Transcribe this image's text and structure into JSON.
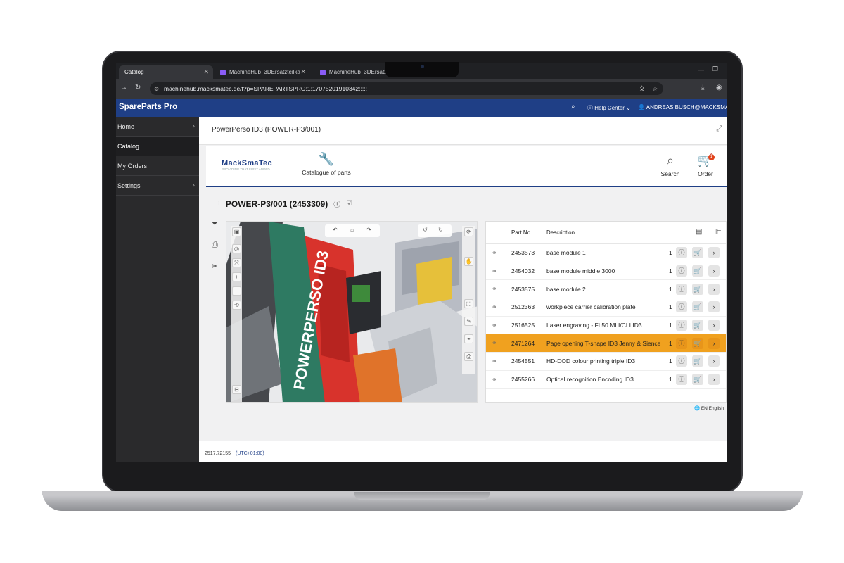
{
  "browser": {
    "tabs": [
      {
        "label": "Catalog",
        "active": true
      },
      {
        "label": "MachineHub_3DErsatzteilkatal",
        "active": false
      },
      {
        "label": "MachineHub_3DErsatztei",
        "active": false
      }
    ],
    "url": "machinehub.macksmatec.de/f?p=SPAREPARTSPRO:1:17075201910342:::::"
  },
  "app": {
    "brand": "SpareParts Pro",
    "help_label": "Help Center",
    "user_label": "ANDREAS.BUSCH@MACKSMATEC.DE"
  },
  "sidebar": {
    "items": [
      {
        "label": "Home",
        "selected": false,
        "has_children": true
      },
      {
        "label": "Catalog",
        "selected": true,
        "has_children": false
      },
      {
        "label": "My Orders",
        "selected": false,
        "has_children": false
      },
      {
        "label": "Settings",
        "selected": false,
        "has_children": true
      }
    ]
  },
  "page": {
    "breadcrumb": "PowerPerso ID3 (POWER-P3/001)",
    "logo_text": "MackSmaTec",
    "logo_tagline": "PROVIDING THAT FIRST ADDED",
    "catalogue_label": "Catalogue of parts",
    "search_label": "Search",
    "order_label": "Order",
    "order_count": "1",
    "title": "POWER-P3/001 (2453309)",
    "viewer_model_label": "POWERPERSO ID3"
  },
  "parts_table": {
    "headers": {
      "part_no": "Part No.",
      "description": "Description"
    },
    "rows": [
      {
        "part_no": "2453573",
        "description": "base module 1",
        "qty": "1",
        "highlighted": false
      },
      {
        "part_no": "2454032",
        "description": "base module middle 3000",
        "qty": "1",
        "highlighted": false
      },
      {
        "part_no": "2453575",
        "description": "base module 2",
        "qty": "1",
        "highlighted": false
      },
      {
        "part_no": "2512363",
        "description": "workpiece carrier calibration plate",
        "qty": "1",
        "highlighted": false
      },
      {
        "part_no": "2516525",
        "description": "Laser engraving - FL50 MLI/CLI ID3",
        "qty": "1",
        "highlighted": false
      },
      {
        "part_no": "2471264",
        "description": "Page opening T-shape ID3 Jenny & Sience",
        "qty": "1",
        "highlighted": true
      },
      {
        "part_no": "2454551",
        "description": "HD-DOD colour printing triple ID3",
        "qty": "1",
        "highlighted": false
      },
      {
        "part_no": "2455266",
        "description": "Optical recognition Encoding ID3",
        "qty": "1",
        "highlighted": false
      }
    ]
  },
  "footer": {
    "time": "2517.72155",
    "timezone": "(UTC+01:00)",
    "language": "EN English"
  },
  "colors": {
    "appbar": "#1f3f86",
    "highlight_row": "#f0a11f",
    "sidebar": "#2a2a2c"
  }
}
